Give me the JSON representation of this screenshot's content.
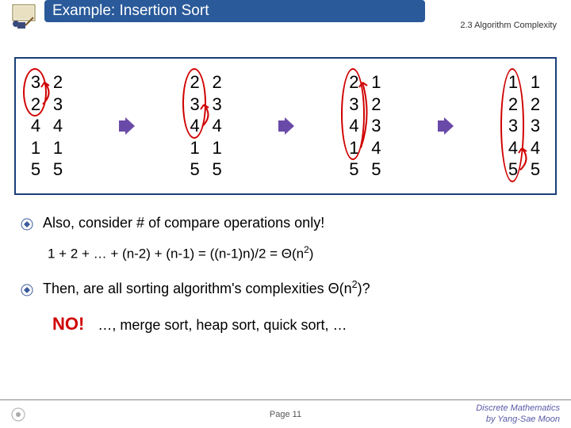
{
  "header": {
    "title": "Example: Insertion Sort",
    "chapter": "2.3 Algorithm Complexity"
  },
  "steps": [
    {
      "left": [
        "3",
        "2",
        "4",
        "1",
        "5"
      ],
      "right": [
        "2",
        "3",
        "4",
        "1",
        "5"
      ],
      "circleTop": 0,
      "circleSpan": 2,
      "arcTop": 0,
      "arcBottom": 1
    },
    {
      "left": [
        "2",
        "3",
        "4",
        "1",
        "5"
      ],
      "right": [
        "2",
        "3",
        "4",
        "1",
        "5"
      ],
      "circleTop": 0,
      "circleSpan": 3,
      "arcTop": 1,
      "arcBottom": 2
    },
    {
      "left": [
        "2",
        "3",
        "4",
        "1",
        "5"
      ],
      "right": [
        "1",
        "2",
        "3",
        "4",
        "5"
      ],
      "circleTop": 0,
      "circleSpan": 4,
      "arcTop": 0,
      "arcBottom": 3
    },
    {
      "left": [
        "1",
        "2",
        "3",
        "4",
        "5"
      ],
      "right": [
        "1",
        "2",
        "3",
        "4",
        "5"
      ],
      "circleTop": 0,
      "circleSpan": 5,
      "arcTop": 3,
      "arcBottom": 4
    }
  ],
  "body": {
    "bullet1": "Also, consider # of compare operations only!",
    "formula_pre": "1 + 2 + … + (n-2) + (n-1) = ((n-1)n)/2 = Θ(n",
    "formula_sup": "2",
    "formula_post": ")",
    "bullet2_pre": "Then, are all sorting algorithm's complexities Θ(n",
    "bullet2_sup": "2",
    "bullet2_post": ")?",
    "no": "NO!",
    "no_rest": "…, merge sort, heap sort, quick sort, …"
  },
  "footer": {
    "page": "Page 11",
    "credit1": "Discrete Mathematics",
    "credit2": "by Yang-Sae Moon"
  }
}
